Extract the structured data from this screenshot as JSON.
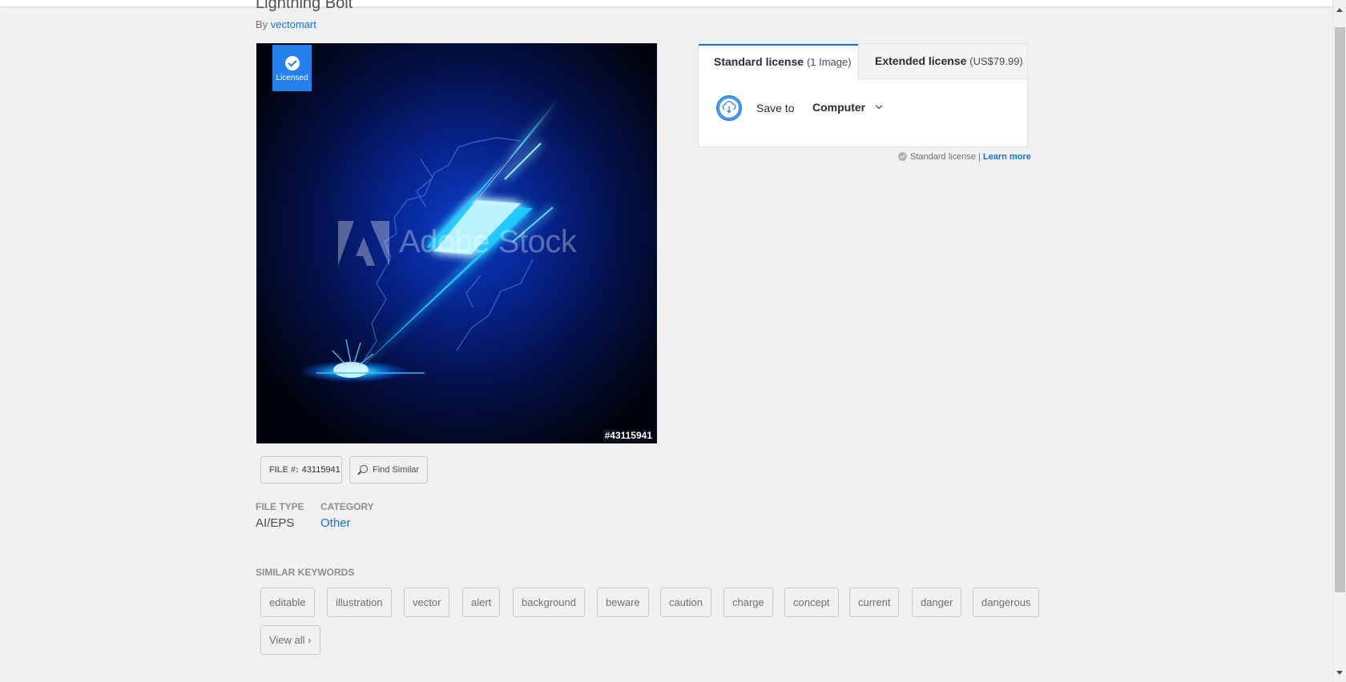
{
  "asset": {
    "title": "Lightning Bolt",
    "by_label": "By",
    "author": "vectomart",
    "licensed_label": "Licensed",
    "id_overlay": "#43115941",
    "watermark": "Adobe Stock"
  },
  "file_button": {
    "key": "FILE #:",
    "value": "43115941"
  },
  "find_similar_label": "Find Similar",
  "meta": {
    "file_type_label": "FILE TYPE",
    "file_type_value": "AI/EPS",
    "category_label": "CATEGORY",
    "category_value": "Other"
  },
  "keywords": {
    "heading": "SIMILAR KEYWORDS",
    "items": [
      "editable",
      "illustration",
      "vector",
      "alert",
      "background",
      "beware",
      "caution",
      "charge",
      "concept",
      "current",
      "danger",
      "dangerous"
    ],
    "view_all": "View all ›"
  },
  "license": {
    "tabs": [
      {
        "name": "Standard license",
        "detail": "(1 Image)"
      },
      {
        "name": "Extended license",
        "detail": "(US$79.99)"
      }
    ],
    "save_to_label": "Save to",
    "save_destination": "Computer",
    "note_text": "Standard license |",
    "learn_more": "Learn more"
  },
  "colors": {
    "accent": "#1473e6",
    "badge": "#2680eb",
    "bolt": "#2fd0ff"
  },
  "icons": [
    "check-circle-icon",
    "search-icon",
    "cloud-download-icon",
    "chevron-down-icon"
  ]
}
